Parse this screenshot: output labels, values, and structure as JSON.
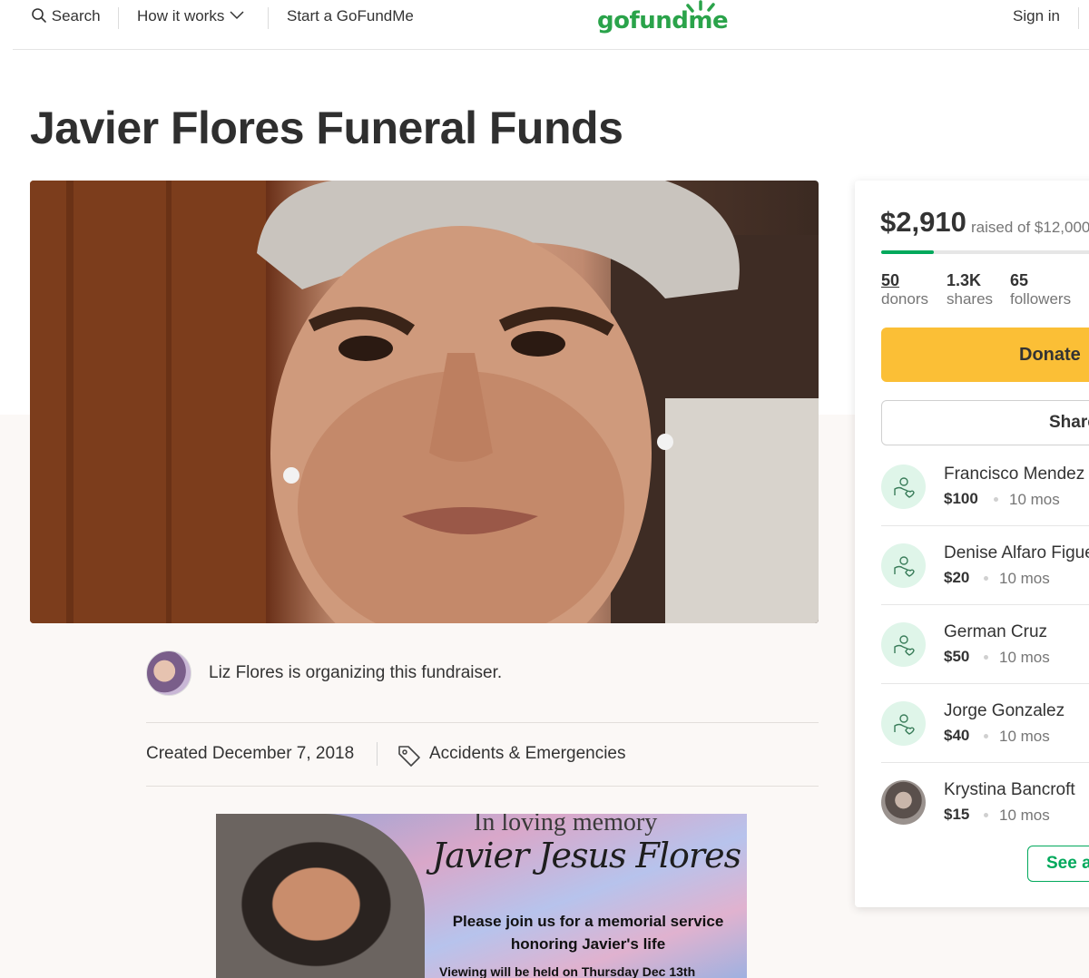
{
  "nav": {
    "search_label": "Search",
    "how_it_works_label": "How it works",
    "start_label": "Start a GoFundMe",
    "sign_in_label": "Sign in",
    "logo_text": "gofundme"
  },
  "campaign": {
    "title": "Javier Flores Funeral Funds",
    "organizer_text": "Liz Flores is organizing this fundraiser.",
    "created": "Created December 7, 2018",
    "category": "Accidents & Emergencies"
  },
  "flyer": {
    "line1": "In loving memory",
    "line2": "Javier Jesus Flores",
    "line3": "Please join us for a memorial service honoring Javier's life",
    "line4": "Viewing will be held on Thursday Dec 13th"
  },
  "donation": {
    "raised": "$2,910",
    "raised_of": "raised of $12,000",
    "progress_fraction": 0.2425,
    "stats": [
      {
        "value": "50",
        "label": "donors"
      },
      {
        "value": "1.3K",
        "label": "shares"
      },
      {
        "value": "65",
        "label": "followers"
      }
    ],
    "donate_label": "Donate",
    "share_label": "Share",
    "see_all_label": "See all"
  },
  "donors": [
    {
      "name": "Francisco Mendez",
      "amount": "$100",
      "time": "10 mos",
      "avatar": "heart-hand-icon"
    },
    {
      "name": "Denise Alfaro Figueroa",
      "amount": "$20",
      "time": "10 mos",
      "avatar": "heart-hand-icon"
    },
    {
      "name": "German Cruz",
      "amount": "$50",
      "time": "10 mos",
      "avatar": "heart-hand-icon"
    },
    {
      "name": "Jorge Gonzalez",
      "amount": "$40",
      "time": "10 mos",
      "avatar": "heart-hand-icon"
    },
    {
      "name": "Krystina Bancroft",
      "amount": "$15",
      "time": "10 mos",
      "avatar": "photo"
    }
  ],
  "colors": {
    "brand_green": "#02a95c",
    "donate_yellow": "#fbbf36"
  }
}
